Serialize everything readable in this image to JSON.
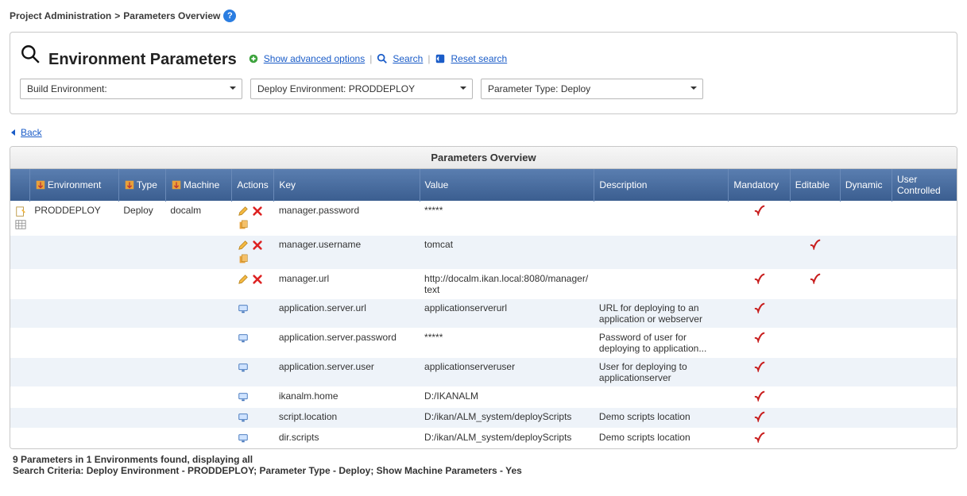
{
  "breadcrumb": {
    "part1": "Project Administration",
    "sep": ">",
    "part2": "Parameters Overview"
  },
  "panel": {
    "title": "Environment Parameters",
    "links": {
      "advanced": "Show advanced options",
      "search": "Search",
      "reset": "Reset search"
    },
    "filters": {
      "build": "Build Environment:",
      "deploy": "Deploy Environment: PRODDEPLOY",
      "paramtype": "Parameter Type: Deploy"
    }
  },
  "back_label": "Back",
  "table": {
    "title": "Parameters Overview",
    "headers": {
      "environment": "Environment",
      "type": "Type",
      "machine": "Machine",
      "actions": "Actions",
      "key": "Key",
      "value": "Value",
      "description": "Description",
      "mandatory": "Mandatory",
      "editable": "Editable",
      "dynamic": "Dynamic",
      "usercontrolled": "User Controlled"
    },
    "rowgroup": {
      "environment": "PRODDEPLOY",
      "type": "Deploy",
      "machine": "docalm"
    },
    "rows": [
      {
        "actions": "edit-delete-copy",
        "key": "manager.password",
        "value": "*****",
        "description": "",
        "mandatory": true,
        "editable": false,
        "dynamic": false,
        "user": false
      },
      {
        "actions": "edit-delete-copy",
        "key": "manager.username",
        "value": "tomcat",
        "description": "",
        "mandatory": false,
        "editable": true,
        "dynamic": false,
        "user": false
      },
      {
        "actions": "edit-delete",
        "key": "manager.url",
        "value": "http://docalm.ikan.local:8080/manager/text",
        "description": "",
        "mandatory": true,
        "editable": true,
        "dynamic": false,
        "user": false
      },
      {
        "actions": "machine",
        "key": "application.server.url",
        "value": "applicationserverurl",
        "description": "URL for deploying to an application or webserver",
        "mandatory": true,
        "editable": false,
        "dynamic": false,
        "user": false
      },
      {
        "actions": "machine",
        "key": "application.server.password",
        "value": "*****",
        "description": "Password of user for deploying to application...",
        "mandatory": true,
        "editable": false,
        "dynamic": false,
        "user": false
      },
      {
        "actions": "machine",
        "key": "application.server.user",
        "value": "applicationserveruser",
        "description": "User for deploying to applicationserver",
        "mandatory": true,
        "editable": false,
        "dynamic": false,
        "user": false
      },
      {
        "actions": "machine",
        "key": "ikanalm.home",
        "value": "D:/IKANALM",
        "description": "",
        "mandatory": true,
        "editable": false,
        "dynamic": false,
        "user": false
      },
      {
        "actions": "machine",
        "key": "script.location",
        "value": "D:/ikan/ALM_system/deployScripts",
        "description": "Demo scripts location",
        "mandatory": true,
        "editable": false,
        "dynamic": false,
        "user": false
      },
      {
        "actions": "machine",
        "key": "dir.scripts",
        "value": "D:/ikan/ALM_system/deployScripts",
        "description": "Demo scripts location",
        "mandatory": true,
        "editable": false,
        "dynamic": false,
        "user": false
      }
    ]
  },
  "footer": {
    "line1": "9 Parameters in 1 Environments found, displaying all",
    "line2": "Search Criteria: Deploy Environment - PRODDEPLOY; Parameter Type - Deploy; Show Machine Parameters - Yes"
  }
}
